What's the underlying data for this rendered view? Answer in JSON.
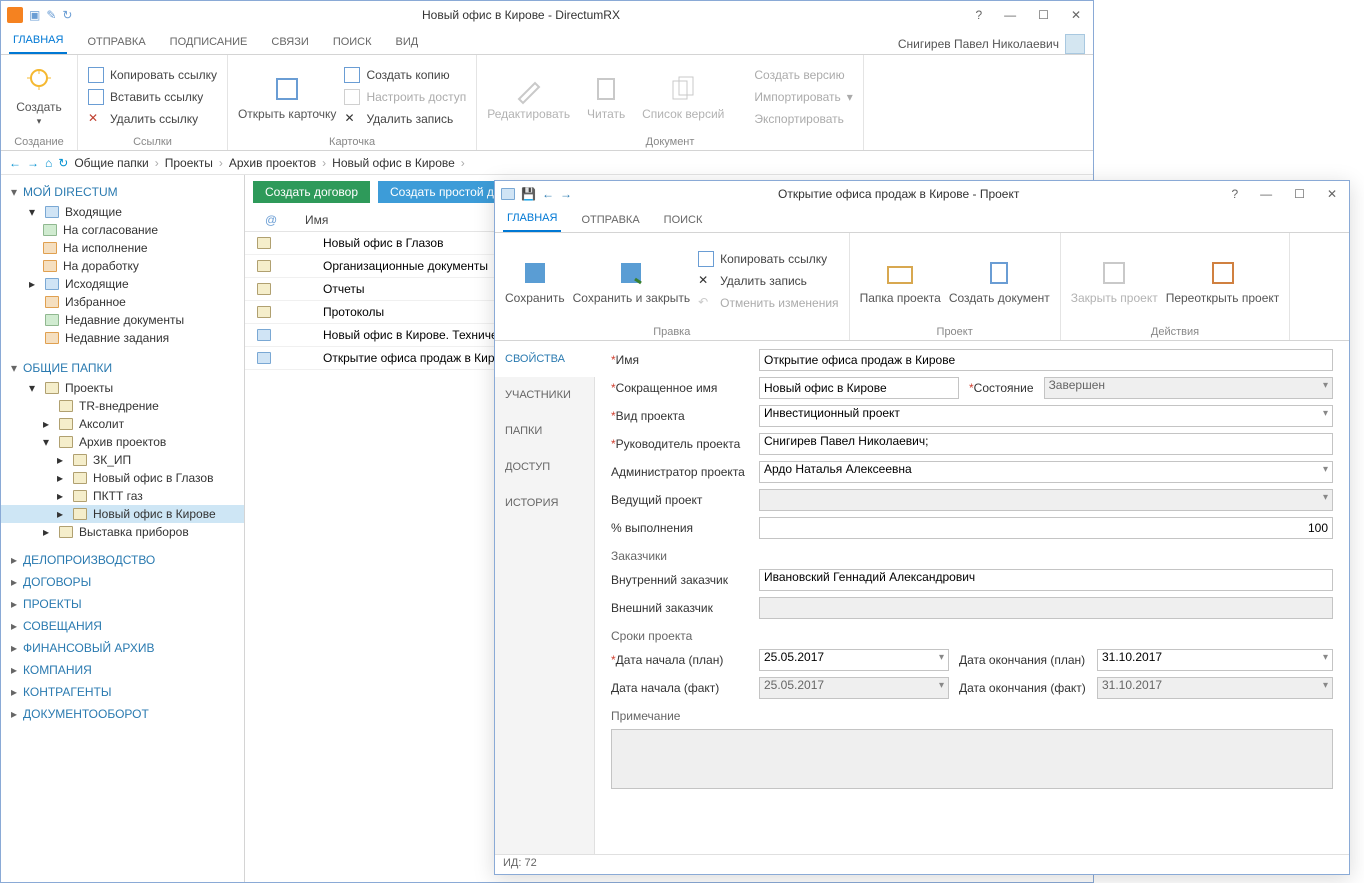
{
  "main": {
    "title": "Новый офис в Кирове - DirectumRX",
    "user": "Снигирев Павел Николаевич",
    "tabs": [
      "ГЛАВНАЯ",
      "ОТПРАВКА",
      "ПОДПИСАНИЕ",
      "СВЯЗИ",
      "ПОИСК",
      "ВИД"
    ],
    "ribbon": {
      "create": "Создать",
      "create_group": "Создание",
      "copy_link": "Копировать ссылку",
      "insert_link": "Вставить ссылку",
      "delete_link": "Удалить ссылку",
      "links_group": "Ссылки",
      "open_card": "Открыть карточку",
      "create_copy": "Создать копию",
      "set_access": "Настроить доступ",
      "delete_rec": "Удалить запись",
      "card_group": "Карточка",
      "edit": "Редактировать",
      "read": "Читать",
      "ver_list": "Список версий",
      "create_ver": "Создать версию",
      "import": "Импортировать",
      "export": "Экспортировать",
      "doc_group": "Документ"
    },
    "breadcrumb": [
      "Общие папки",
      "Проекты",
      "Архив проектов",
      "Новый офис в Кирове"
    ],
    "nav": {
      "mydir": "МОЙ DIRECTUM",
      "incoming": "Входящие",
      "on_approve": "На согласование",
      "on_exec": "На исполнение",
      "on_rework": "На доработку",
      "outgoing": "Исходящие",
      "fav": "Избранное",
      "recent_docs": "Недавние документы",
      "recent_tasks": "Недавние задания",
      "shared": "ОБЩИЕ ПАПКИ",
      "projects": "Проекты",
      "tr": "TR-внедрение",
      "aksolit": "Аксолит",
      "archive": "Архив проектов",
      "zk": "ЗК_ИП",
      "glazov": "Новый офис в Глазов",
      "pktt": "ПКТТ газ",
      "kirov": "Новый офис в Кирове",
      "expo": "Выставка приборов",
      "dp": "ДЕЛОПРОИЗВОДСТВО",
      "contracts": "ДОГОВОРЫ",
      "proj2": "ПРОЕКТЫ",
      "meet": "СОВЕЩАНИЯ",
      "finarch": "ФИНАНСОВЫЙ АРХИВ",
      "company": "КОМПАНИЯ",
      "contr": "КОНТРАГЕНТЫ",
      "docflow": "ДОКУМЕНТООБОРОТ"
    },
    "toolbar": {
      "create_contract": "Создать договор",
      "create_simple": "Создать простой документ"
    },
    "list_header": "Имя",
    "rows": [
      {
        "icon": "folder",
        "name": "Новый офис в Глазов"
      },
      {
        "icon": "folder",
        "name": "Организационные документы"
      },
      {
        "icon": "folder",
        "name": "Отчеты"
      },
      {
        "icon": "folder",
        "name": "Протоколы"
      },
      {
        "icon": "word",
        "name": "Новый офис в Кирове. Технический план"
      },
      {
        "icon": "card",
        "name": "Открытие офиса продаж в Кирове"
      }
    ]
  },
  "dialog": {
    "title": "Открытие офиса продаж в Кирове - Проект",
    "tabs": [
      "ГЛАВНАЯ",
      "ОТПРАВКА",
      "ПОИСК"
    ],
    "ribbon": {
      "save": "Сохранить",
      "save_close": "Сохранить и закрыть",
      "copy_link": "Копировать ссылку",
      "delete_rec": "Удалить запись",
      "undo": "Отменить изменения",
      "edit_group": "Правка",
      "proj_folder": "Папка проекта",
      "create_doc": "Создать документ",
      "proj_group": "Проект",
      "close_proj": "Закрыть проект",
      "reopen": "Переоткрыть проект",
      "actions_group": "Действия"
    },
    "side_tabs": [
      "СВОЙСТВА",
      "УЧАСТНИКИ",
      "ПАПКИ",
      "ДОСТУП",
      "ИСТОРИЯ"
    ],
    "form": {
      "name_label": "Имя",
      "name": "Открытие офиса продаж в Кирове",
      "short_label": "Сокращенное имя",
      "short": "Новый офис в Кирове",
      "status_label": "Состояние",
      "status": "Завершен",
      "type_label": "Вид проекта",
      "type": "Инвестиционный проект",
      "manager_label": "Руководитель проекта",
      "manager": "Снигирев Павел Николаевич;",
      "admin_label": "Администратор проекта",
      "admin": "Ардо Наталья Алексеевна",
      "lead_label": "Ведущий проект",
      "lead": "",
      "percent_label": "% выполнения",
      "percent": "100",
      "customers_hdr": "Заказчики",
      "int_cust_label": "Внутренний заказчик",
      "int_cust": "Ивановский Геннадий Александрович",
      "ext_cust_label": "Внешний заказчик",
      "ext_cust": "",
      "dates_hdr": "Сроки проекта",
      "start_plan_label": "Дата начала (план)",
      "start_plan": "25.05.2017",
      "end_plan_label": "Дата окончания (план)",
      "end_plan": "31.10.2017",
      "start_fact_label": "Дата начала (факт)",
      "start_fact": "25.05.2017",
      "end_fact_label": "Дата окончания (факт)",
      "end_fact": "31.10.2017",
      "note_label": "Примечание",
      "note": "",
      "status_id": "ИД: 72"
    }
  }
}
